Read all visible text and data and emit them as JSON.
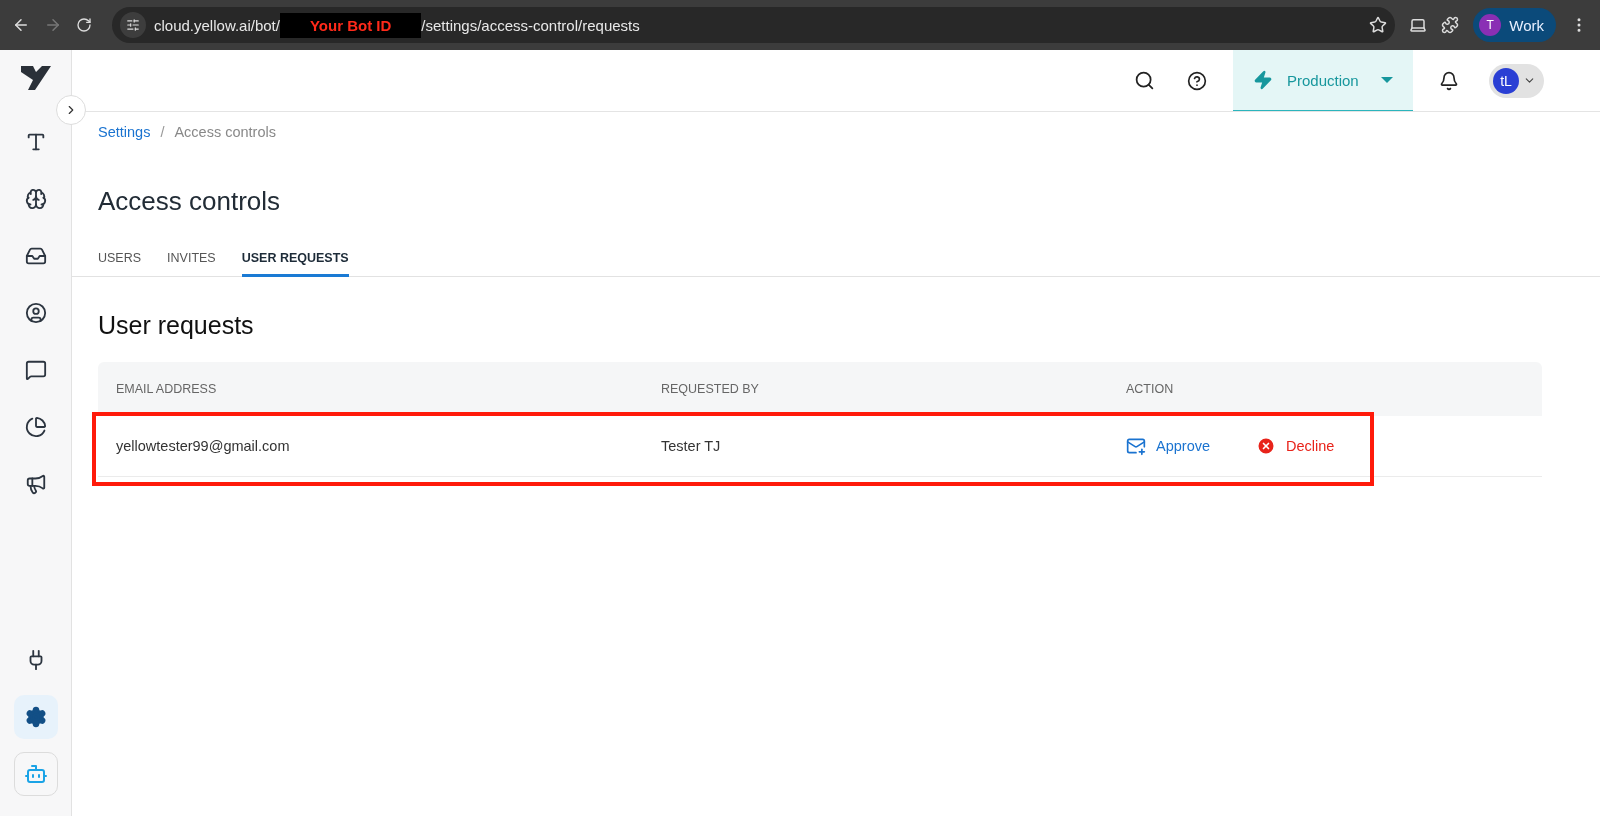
{
  "browser": {
    "url_prefix": "cloud.yellow.ai/bot/",
    "redaction": "Your Bot ID",
    "url_suffix": "/settings/access-control/requests",
    "profile": {
      "initial": "T",
      "name": "Work"
    }
  },
  "sidebar": {
    "items": [
      {
        "kind": "text",
        "selected": false
      },
      {
        "kind": "brain",
        "selected": false
      },
      {
        "kind": "inbox",
        "selected": false
      },
      {
        "kind": "user",
        "selected": false
      },
      {
        "kind": "insights",
        "selected": false
      },
      {
        "kind": "pie",
        "selected": false
      },
      {
        "kind": "megaphone",
        "selected": false
      }
    ],
    "bottom_items": [
      {
        "kind": "plug",
        "selected": false
      },
      {
        "kind": "settings",
        "selected": true
      }
    ]
  },
  "header": {
    "environment": "Production",
    "avatar": "tL"
  },
  "breadcrumb": {
    "separator": "/",
    "items": [
      {
        "label": "Settings",
        "kind": "link"
      },
      {
        "label": "Access controls",
        "kind": "current"
      }
    ]
  },
  "title": "Access controls",
  "tabs": [
    {
      "label": "USERS",
      "selected": false
    },
    {
      "label": "INVITES",
      "selected": false
    },
    {
      "label": "USER REQUESTS",
      "selected": true
    }
  ],
  "section_title": "User requests",
  "table": {
    "columns": [
      "EMAIL ADDRESS",
      "REQUESTED BY",
      "ACTION"
    ],
    "rows": [
      {
        "email": "yellowtester99@gmail.com",
        "requested_by": "Tester TJ",
        "highlighted": true,
        "actions": [
          {
            "label": "Approve",
            "kind": "approve"
          },
          {
            "label": "Decline",
            "kind": "decline"
          }
        ]
      }
    ]
  }
}
